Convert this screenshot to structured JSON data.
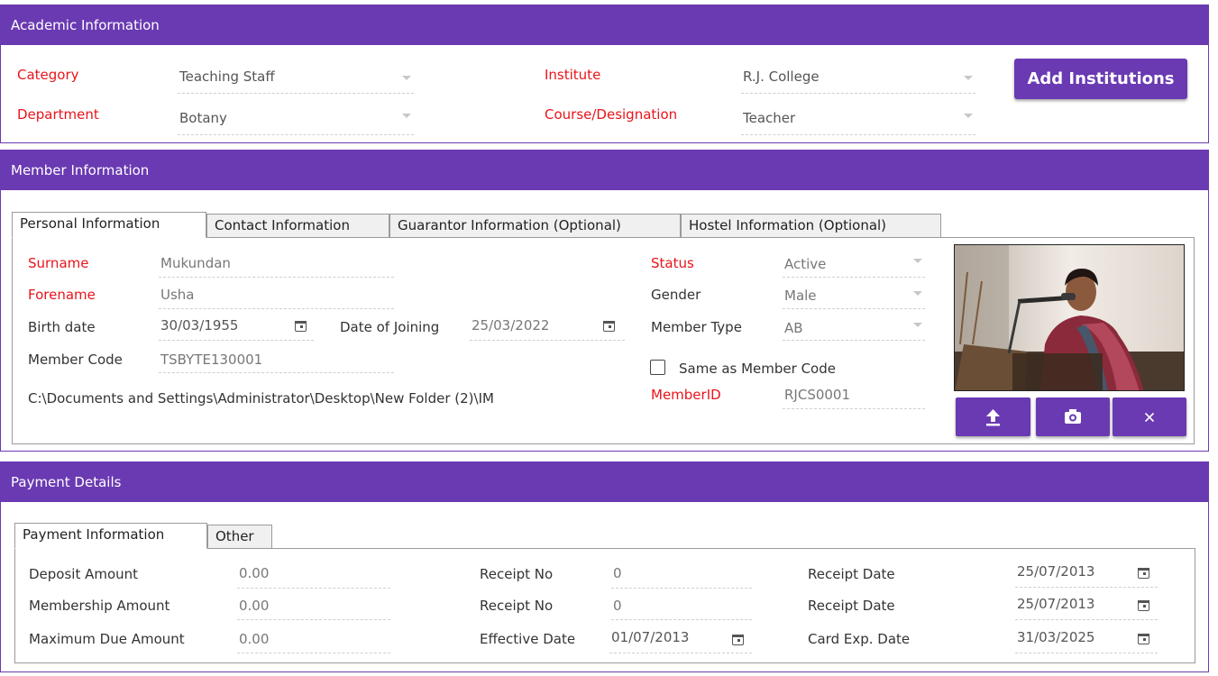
{
  "academic": {
    "title": "Academic Information",
    "category_label": "Category",
    "category_value": "Teaching Staff",
    "department_label": "Department",
    "department_value": "Botany",
    "institute_label": "Institute",
    "institute_value": "R.J. College",
    "course_label": "Course/Designation",
    "course_value": "Teacher",
    "add_button": "Add Institutions"
  },
  "member": {
    "title": "Member Information",
    "tabs": [
      "Personal Information",
      "Contact Information",
      "Guarantor Information (Optional)",
      "Hostel Information (Optional)"
    ],
    "surname_label": "Surname",
    "surname_value": "Mukundan",
    "forename_label": "Forename",
    "forename_value": "Usha",
    "birth_label": "Birth date",
    "birth_value": "30/03/1955",
    "joining_label": "Date of Joining",
    "joining_value": "25/03/2022",
    "code_label": "Member Code",
    "code_value": "TSBYTE130001",
    "path_text": "C:\\Documents and Settings\\Administrator\\Desktop\\New Folder (2)\\IM",
    "status_label": "Status",
    "status_value": "Active",
    "gender_label": "Gender",
    "gender_value": "Male",
    "type_label": "Member Type",
    "type_value": "AB",
    "same_code_label": "Same as Member Code",
    "same_code_checked": false,
    "memberid_label": "MemberID",
    "memberid_value": "RJCS0001",
    "photo_buttons": [
      "upload-icon",
      "camera-icon",
      "close-icon"
    ]
  },
  "payment": {
    "title": "Payment Details",
    "tabs": [
      "Payment Information",
      "Other"
    ],
    "deposit_label": "Deposit Amount",
    "deposit_value": "0.00",
    "membership_label": "Membership Amount",
    "membership_value": "0.00",
    "maxdue_label": "Maximum Due Amount",
    "maxdue_value": "0.00",
    "receipt1_label": "Receipt No",
    "receipt1_value": "0",
    "receipt2_label": "Receipt No",
    "receipt2_value": "0",
    "effective_label": "Effective Date",
    "effective_value": "01/07/2013",
    "rdate1_label": "Receipt Date",
    "rdate1_value": "25/07/2013",
    "rdate2_label": "Receipt Date",
    "rdate2_value": "25/07/2013",
    "cardexp_label": "Card Exp. Date",
    "cardexp_value": "31/03/2025"
  },
  "colors": {
    "accent": "#6a3ab2",
    "required": "#e8141b"
  }
}
